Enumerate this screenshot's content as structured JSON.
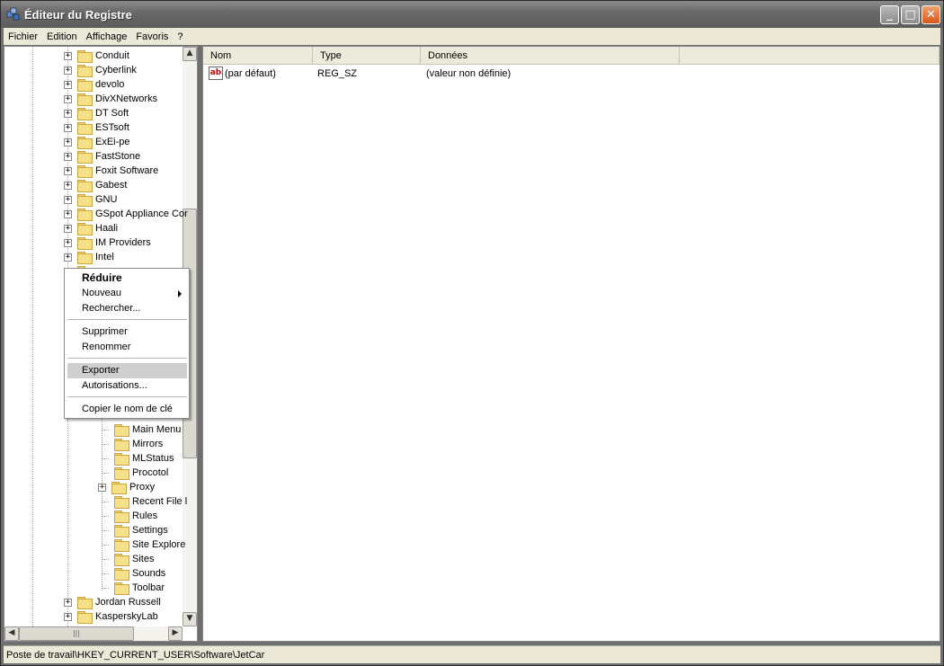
{
  "window": {
    "title": "Éditeur du Registre"
  },
  "menubar": [
    "Fichier",
    "Edition",
    "Affichage",
    "Favoris",
    "?"
  ],
  "tree": {
    "top_items": [
      "Conduit",
      "Cyberlink",
      "devolo",
      "DivXNetworks",
      "DT Soft",
      "ESTsoft",
      "ExEi-pe",
      "FastStone",
      "Foxit Software",
      "Gabest",
      "GNU",
      "GSpot Appliance Cor",
      "Haali",
      "IM Providers",
      "Intel"
    ],
    "sub_items": [
      "Main Menu",
      "Mirrors",
      "MLStatus",
      "Procotol",
      "Proxy",
      "Recent File l",
      "Rules",
      "Settings",
      "Site Explore",
      "Sites",
      "Sounds",
      "Toolbar"
    ],
    "bottom_items": [
      "Jordan Russell",
      "KasperskyLab"
    ]
  },
  "values": {
    "headers": {
      "name": "Nom",
      "type": "Type",
      "data": "Données"
    },
    "rows": [
      {
        "name": "(par défaut)",
        "type": "REG_SZ",
        "data": "(valeur non définie)",
        "icon": "ab-string-icon"
      }
    ]
  },
  "context_menu": {
    "items": [
      "Réduire",
      "Nouveau",
      "Rechercher...",
      "Supprimer",
      "Renommer",
      "Exporter",
      "Autorisations...",
      "Copier le nom de clé"
    ],
    "highlighted": "Exporter"
  },
  "statusbar": {
    "path": "Poste de travail\\HKEY_CURRENT_USER\\Software\\JetCar"
  }
}
